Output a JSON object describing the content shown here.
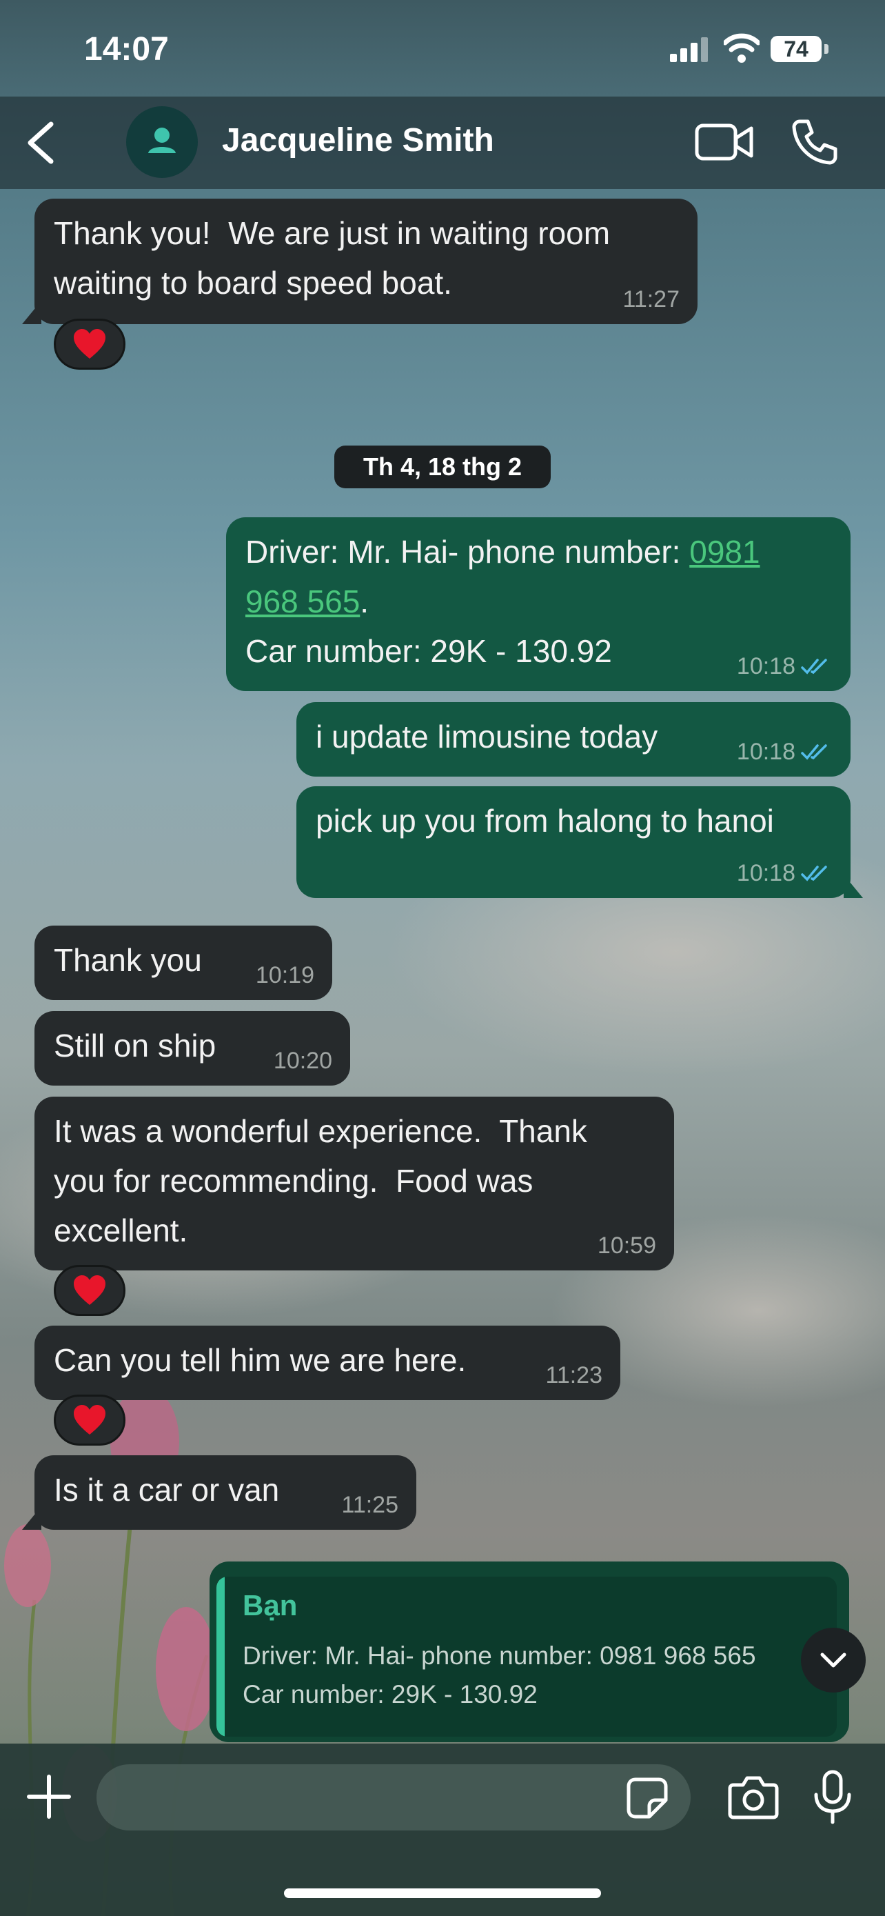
{
  "status_bar": {
    "time": "14:07",
    "battery": "74"
  },
  "header": {
    "contact_name": "Jacqueline Smith"
  },
  "date_separator": "Th 4, 18 thg 2",
  "messages": [
    {
      "dir": "in",
      "text": "Thank you!  We are just in waiting room\nwaiting to board speed boat.",
      "time": "11:27",
      "reaction": "❤️"
    },
    {
      "dir": "out",
      "text_before": "Driver: Mr. Hai- phone number: ",
      "phone": "0981\n968 565",
      "text_after": ".\nCar number: 29K - 130.92",
      "time": "10:18"
    },
    {
      "dir": "out",
      "text": "i update limousine today",
      "time": "10:18"
    },
    {
      "dir": "out",
      "text": "pick up you from halong to hanoi",
      "time": "10:18"
    },
    {
      "dir": "in",
      "text": "Thank you",
      "time": "10:19"
    },
    {
      "dir": "in",
      "text": "Still on ship",
      "time": "10:20"
    },
    {
      "dir": "in",
      "text": "It was a wonderful experience.  Thank\nyou for recommending.  Food was\nexcellent.",
      "time": "10:59",
      "reaction": "❤️"
    },
    {
      "dir": "in",
      "text": "Can you tell him we are here.",
      "time": "11:23",
      "reaction": "❤️"
    },
    {
      "dir": "in",
      "text": "Is it a car or van",
      "time": "11:25"
    }
  ],
  "quoted_reply": {
    "sender": "Bạn",
    "line1": "Driver: Mr. Hai- phone number: 0981 968 565",
    "line2": "Car number: 29K - 130.92"
  },
  "colors": {
    "incoming_bubble": "#262a2c",
    "outgoing_bubble": "#135843",
    "link": "#4ac77d",
    "read_ticks": "#53bdeb"
  }
}
